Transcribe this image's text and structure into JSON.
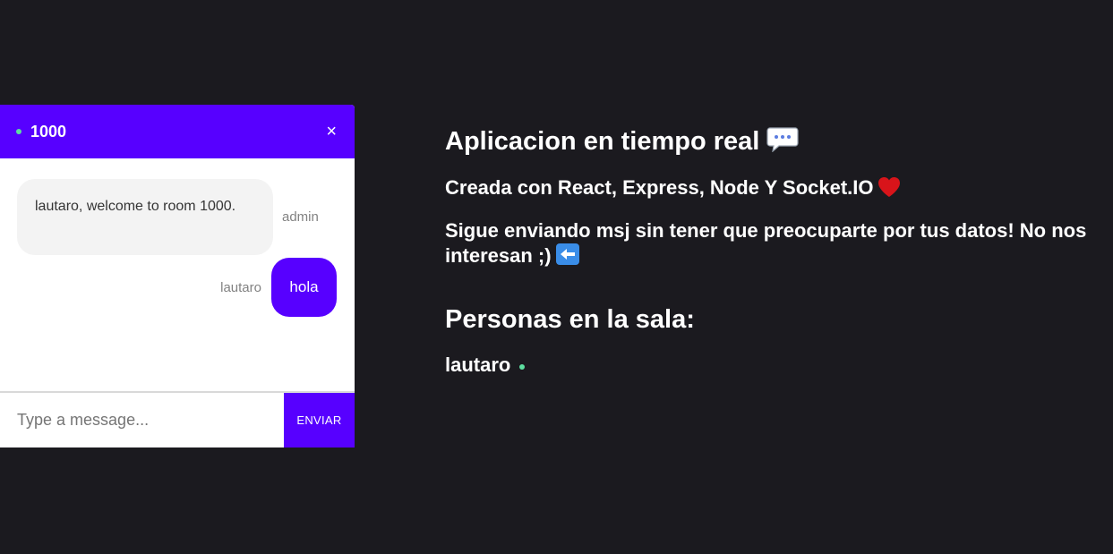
{
  "chat": {
    "room": "1000",
    "close_label": "×",
    "messages": [
      {
        "sender": "admin",
        "text": "lautaro, welcome to room 1000."
      },
      {
        "sender": "lautaro",
        "text": "hola"
      }
    ],
    "input_placeholder": "Type a message...",
    "send_label": "ENVIAR"
  },
  "info": {
    "title": "Aplicacion en tiempo real",
    "subtitle": "Creada con React, Express, Node Y Socket.IO",
    "description": "Sigue enviando msj sin tener que preocuparte por tus datos! No nos interesan ;)",
    "people_title": "Personas en la sala:",
    "people": [
      "lautaro"
    ]
  },
  "icons": {
    "title_icon": "speech-balloon-icon",
    "subtitle_icon": "heart-icon",
    "description_icon": "left-arrow-icon",
    "online_indicator": "online-dot-icon"
  },
  "colors": {
    "background": "#1b1a1f",
    "accent": "#5700ff",
    "online": "#5ddfa0",
    "bubble_gray": "#f3f3f3"
  }
}
